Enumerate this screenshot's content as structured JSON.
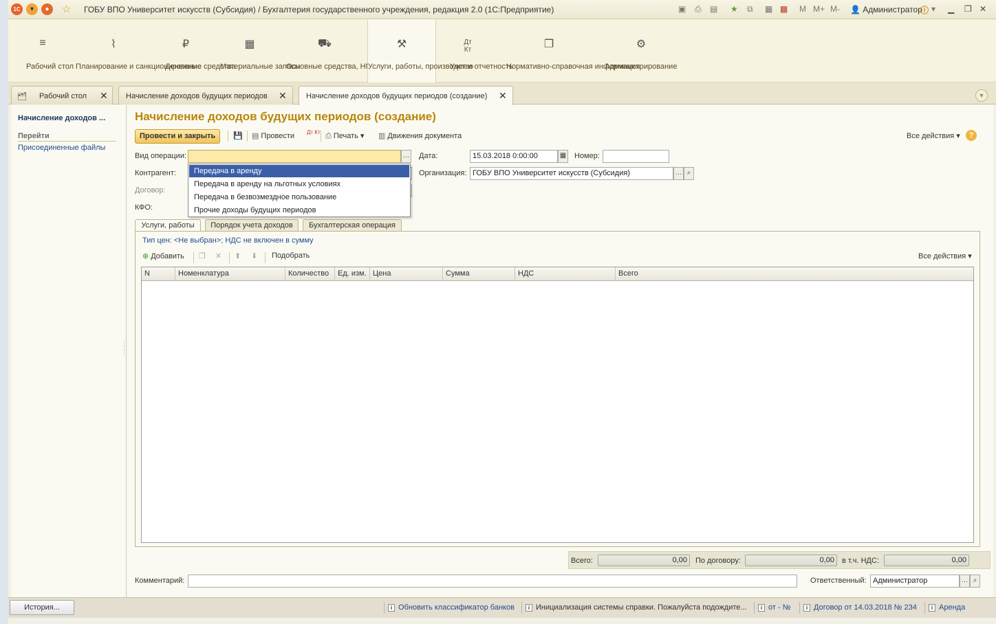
{
  "window": {
    "title": "ГОБУ ВПО Университет искусств (Субсидия) / Бухгалтерия государственного учреждения, редакция 2.0  (1С:Предприятие)",
    "logo": "1С",
    "user": "Администратор",
    "m_labels": [
      "M",
      "M+",
      "M-"
    ]
  },
  "sections": [
    {
      "label": "Рабочий стол",
      "icon": "menu-icon"
    },
    {
      "label": "Планирование и санкционирование",
      "icon": "chart-icon"
    },
    {
      "label": "Денежные средства",
      "icon": "ruble-icon"
    },
    {
      "label": "Материальные запасы",
      "icon": "grid-icon"
    },
    {
      "label": "Основные средства, НМА, НПА",
      "icon": "truck-icon"
    },
    {
      "label": "Услуги, работы, производство",
      "icon": "tools-icon"
    },
    {
      "label": "Учет и отчетность",
      "icon": "dt-kt-icon"
    },
    {
      "label": "Нормативно-справочная информация",
      "icon": "docs-icon"
    },
    {
      "label": "Администрирование",
      "icon": "gear-icon"
    }
  ],
  "open_tabs": [
    {
      "label": "Рабочий стол"
    },
    {
      "label": "Начисление доходов будущих периодов"
    },
    {
      "label": "Начисление доходов будущих периодов (создание)"
    }
  ],
  "left_panel": {
    "title": "Начисление доходов ...",
    "goto": "Перейти",
    "link": "Присоединенные файлы"
  },
  "form": {
    "title": "Начисление доходов будущих периодов (создание)",
    "commands": {
      "post_close": "Провести и закрыть",
      "post": "Провести",
      "dtkt": "Дт Кт",
      "print": "Печать",
      "movements": "Движения документа",
      "all_actions": "Все действия"
    },
    "fields": {
      "operation_label": "Вид операции:",
      "operation_value": "",
      "counterparty_label": "Контрагент:",
      "contract_label": "Договор:",
      "kfo_label": "КФО:",
      "date_label": "Дата:",
      "date_value": "15.03.2018  0:00:00",
      "number_label": "Номер:",
      "number_value": "",
      "org_label": "Организация:",
      "org_value": "ГОБУ ВПО Университет искусств (Субсидия)"
    },
    "dropdown_options": [
      "Передача в аренду",
      "Передача в аренду на льготных условиях",
      "Передача в безвозмездное пользование",
      "Прочие доходы будущих периодов"
    ],
    "tabs": [
      "Услуги, работы",
      "Порядок учета доходов",
      "Бухгалтерская операция"
    ],
    "price_type_link": "Тип цен: <Не выбран>; НДС не включен в сумму",
    "table_commands": {
      "add": "Добавить",
      "pick": "Подобрать",
      "all_actions": "Все действия"
    },
    "table_columns": [
      "N",
      "Номенклатура",
      "Количество",
      "Ед. изм.",
      "Цена",
      "Сумма",
      "НДС",
      "Всего"
    ],
    "totals": {
      "total_label": "Всего:",
      "total_value": "0,00",
      "contract_label": "По договору:",
      "contract_value": "0,00",
      "vat_label": "в т.ч. НДС:",
      "vat_value": "0,00"
    },
    "comment_label": "Комментарий:",
    "comment_value": "",
    "responsible_label": "Ответственный:",
    "responsible_value": "Администратор"
  },
  "statusbar": {
    "history": "История...",
    "items": [
      "Обновить классификатор банков",
      "Инициализация системы справки. Пожалуйста подождите...",
      "от - №",
      "Договор от 14.03.2018 № 234",
      "Аренда"
    ]
  }
}
